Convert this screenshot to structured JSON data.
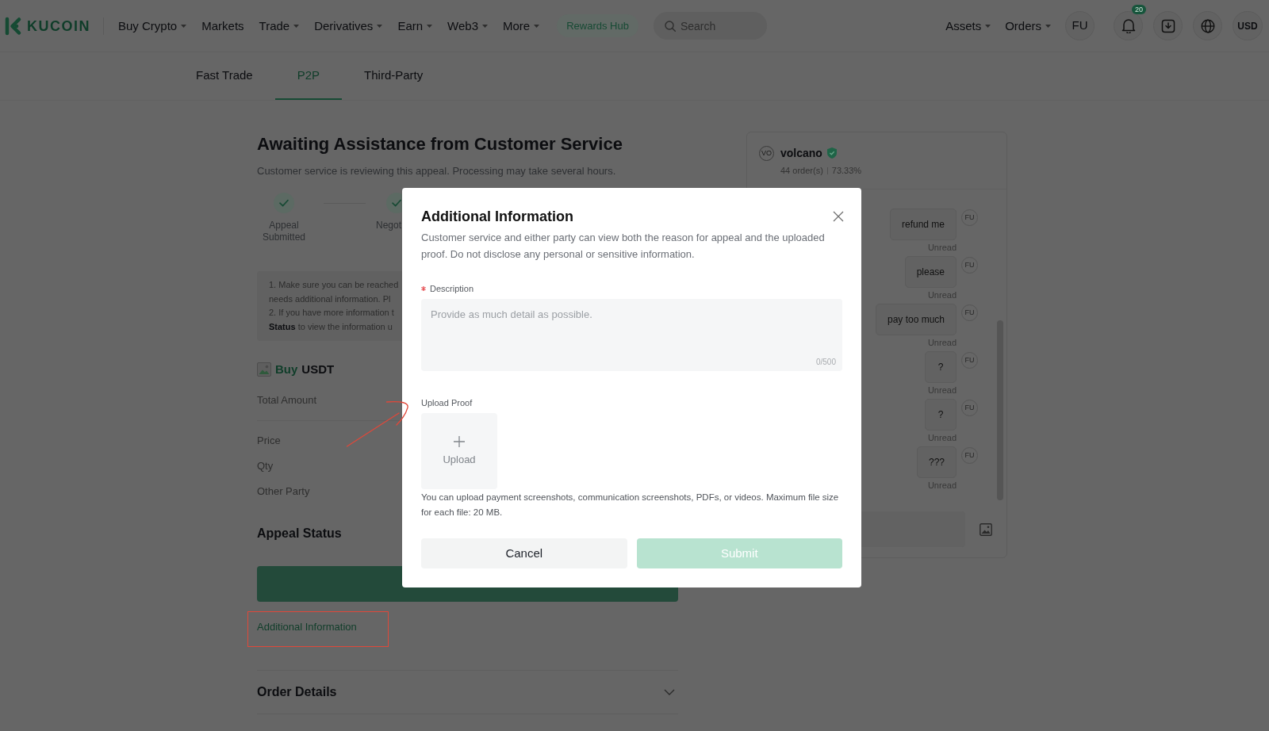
{
  "header": {
    "logo": "KUCOIN",
    "nav": [
      {
        "label": "Buy Crypto",
        "dropdown": true
      },
      {
        "label": "Markets",
        "dropdown": false
      },
      {
        "label": "Trade",
        "dropdown": true
      },
      {
        "label": "Derivatives",
        "dropdown": true
      },
      {
        "label": "Earn",
        "dropdown": true
      },
      {
        "label": "Web3",
        "dropdown": true
      },
      {
        "label": "More",
        "dropdown": true
      }
    ],
    "rewards_button": "Rewards Hub",
    "search": {
      "placeholder": "Search"
    },
    "account_menu": [
      {
        "label": "Assets",
        "dropdown": true
      },
      {
        "label": "Orders",
        "dropdown": true
      }
    ],
    "avatar": "FU",
    "notification_count": "20",
    "currency": "USD"
  },
  "tabs": [
    {
      "label": "Fast Trade",
      "selected": false
    },
    {
      "label": "P2P",
      "selected": true
    },
    {
      "label": "Third-Party",
      "selected": false
    }
  ],
  "appeal": {
    "title": "Awaiting Assistance from Customer Service",
    "subtitle": "Customer service is reviewing this appeal. Processing may take several hours.",
    "steps": [
      {
        "label": "Appeal Submitted",
        "done": true
      },
      {
        "label": "Negot",
        "done": true
      }
    ],
    "notes": [
      "1. Make sure you can be reached",
      "needs additional information. Pl",
      "2. If you have more information t",
      "**Status** to view the information u"
    ],
    "order_side": "Buy",
    "order_asset": "USDT",
    "details": [
      "Total Amount",
      "Price",
      "Qty",
      "Other Party"
    ],
    "status_heading": "Appeal Status",
    "additional_info_link": "Additional Information",
    "order_details": {
      "label": "Order Details",
      "expanded": false
    }
  },
  "chat": {
    "user": {
      "avatar": "VO",
      "name": "volcano",
      "verified": true,
      "orders": "44 order(s)",
      "completion": "73.33%"
    },
    "messages": [
      {
        "text": "refund me",
        "avatar": "FU",
        "status": "Unread"
      },
      {
        "text": "please",
        "avatar": "FU",
        "status": "Unread"
      },
      {
        "text": "pay too much",
        "avatar": "FU",
        "status": "Unread"
      },
      {
        "text": "?",
        "avatar": "FU",
        "status": "Unread"
      },
      {
        "text": "?",
        "avatar": "FU",
        "status": "Unread"
      },
      {
        "text": "???",
        "avatar": "FU",
        "status": "Unread"
      }
    ]
  },
  "modal": {
    "title": "Additional Information",
    "description": "Customer service and either party can view both the reason for appeal and the uploaded proof. Do not disclose any personal or sensitive information.",
    "field": {
      "label": "Description",
      "required": true,
      "placeholder": "Provide as much detail as possible.",
      "counter": "0/500"
    },
    "upload": {
      "label": "Upload Proof",
      "button": "Upload",
      "hint": "You can upload payment screenshots, communication screenshots, PDFs, or videos. Maximum file size for each file: 20 MB."
    },
    "buttons": [
      {
        "label": "Cancel",
        "kind": "secondary",
        "disabled": false
      },
      {
        "label": "Submit",
        "kind": "primary",
        "disabled": true
      }
    ]
  },
  "annotations": {
    "arrow": true,
    "highlight_box": true
  }
}
